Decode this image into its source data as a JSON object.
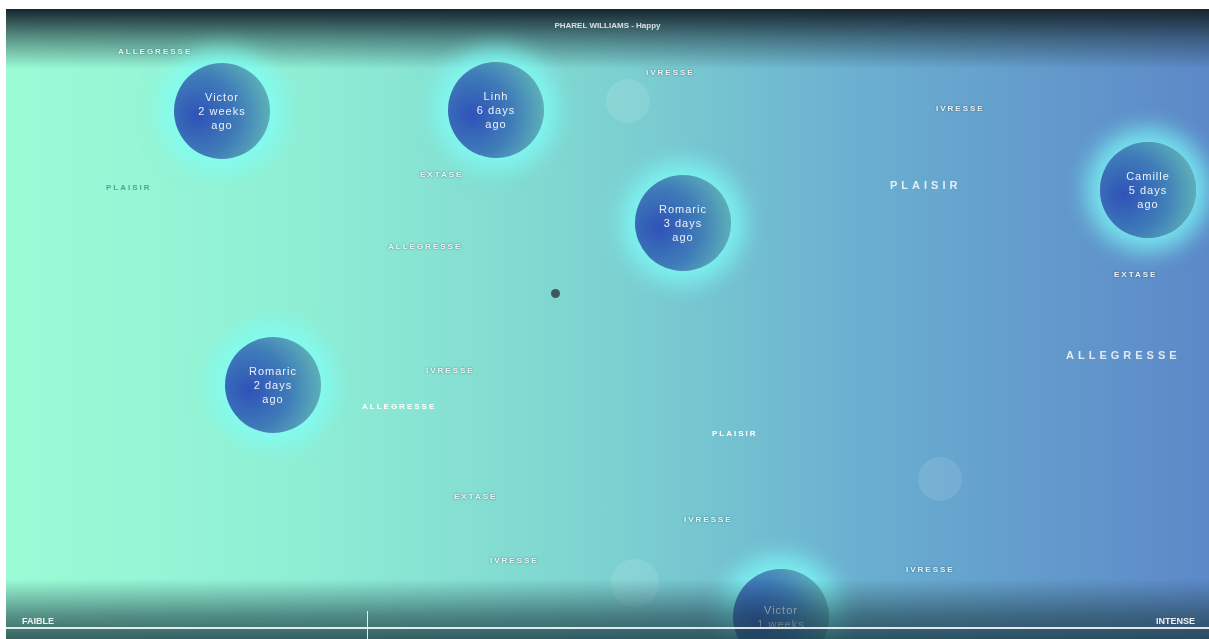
{
  "title": "PHAREL WILLIAMS - Happy",
  "background_words": [
    {
      "text": "ALLEGRESSE",
      "kind": "faint"
    },
    {
      "text": "PLAISIR",
      "kind": "faint"
    },
    {
      "text": "EXTASE",
      "kind": "faint"
    },
    {
      "text": "ALLEGRESSE",
      "kind": "faint"
    },
    {
      "text": "IVRESSE",
      "kind": "faint"
    },
    {
      "text": "IVRESSE",
      "kind": "faint"
    },
    {
      "text": "PLAISIR",
      "kind": "large"
    },
    {
      "text": "EXTASE",
      "kind": "faint"
    },
    {
      "text": "ALLEGRESSE",
      "kind": "large"
    },
    {
      "text": "ALLEGRESSE",
      "kind": "bright"
    },
    {
      "text": "IVRESSE",
      "kind": "faint"
    },
    {
      "text": "PLAISIR",
      "kind": "bright"
    },
    {
      "text": "EXTASE",
      "kind": "faint"
    },
    {
      "text": "IVRESSE",
      "kind": "faint"
    },
    {
      "text": "IVRESSE",
      "kind": "faint"
    },
    {
      "text": "IVRESSE",
      "kind": "faint"
    }
  ],
  "bubbles": [
    {
      "lines": [
        "Victor",
        "2 weeks",
        "ago"
      ]
    },
    {
      "lines": [
        "Linh",
        "6 days",
        "ago"
      ]
    },
    {
      "lines": [
        "Romaric",
        "3 days",
        "ago"
      ]
    },
    {
      "lines": [
        "Camille",
        "5 days",
        "ago"
      ]
    },
    {
      "lines": [
        "Romaric",
        "2 days",
        "ago"
      ]
    },
    {
      "lines": [
        "Victor",
        "1 weeks"
      ]
    }
  ],
  "axis": {
    "low_label": "FAIBLE",
    "high_label": "INTENSE"
  }
}
